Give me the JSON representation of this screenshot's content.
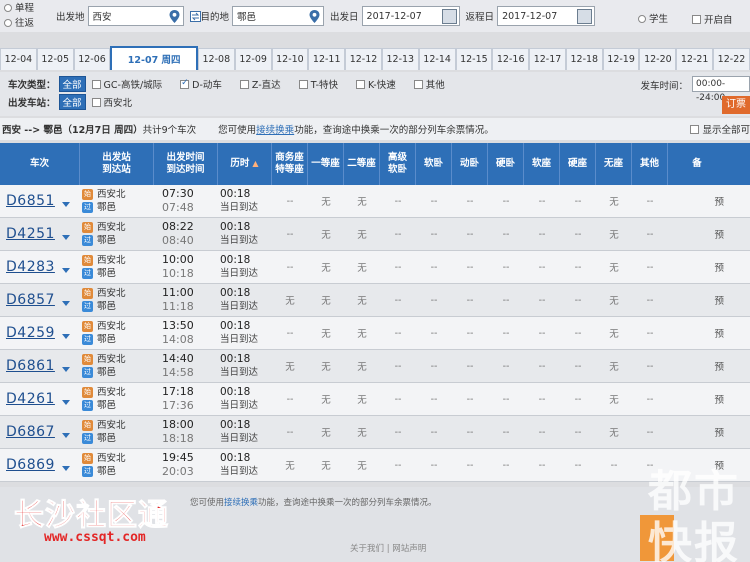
{
  "search": {
    "radio_single": "单程",
    "radio_return": "往返",
    "from_label": "出发地",
    "from_value": "西安",
    "to_label": "目的地",
    "to_value": "鄠邑",
    "date_label": "出发日",
    "date_value": "2017-12-07",
    "return_label": "返程日",
    "return_value": "2017-12-07",
    "passenger_student": "学生",
    "open_option": "开启自"
  },
  "date_tabs": [
    "12-04",
    "12-05",
    "12-06",
    "12-07 周四",
    "12-08",
    "12-09",
    "12-10",
    "12-11",
    "12-12",
    "12-13",
    "12-14",
    "12-15",
    "12-16",
    "12-17",
    "12-18",
    "12-19",
    "12-20",
    "12-21",
    "12-22"
  ],
  "active_date_index": 3,
  "filters": {
    "type_label": "车次类型：",
    "all_label": "全部",
    "options": [
      {
        "label": "GC-高铁/城际",
        "checked": false
      },
      {
        "label": "D-动车",
        "checked": true
      },
      {
        "label": "Z-直达",
        "checked": false
      },
      {
        "label": "T-特快",
        "checked": false
      },
      {
        "label": "K-快速",
        "checked": false
      },
      {
        "label": "其他",
        "checked": false
      }
    ],
    "station_label": "出发车站：",
    "station_all": "全部",
    "station_option": "西安北",
    "time_label": "发车时间：",
    "time_value": "00:00--24:00",
    "book_label": "订票"
  },
  "summary": {
    "route": "西安 --> 鄠邑（12月7日 周四）",
    "count": "共计9个车次",
    "hint_pre": "您可使用",
    "hint_link": "接续换乘",
    "hint_post": "功能，查询途中换乘一次的部分列车余票情况。",
    "show_all": "显示全部可"
  },
  "table": {
    "headers": {
      "train": "车次",
      "station_1": "出发站",
      "station_2": "到达站",
      "time_1": "出发时间",
      "time_2": "到达时间",
      "duration": "历时",
      "sort_indicator": "▲",
      "biz_1": "商务座",
      "biz_2": "特等座",
      "first": "一等座",
      "second": "二等座",
      "adv_1": "高级",
      "adv_2": "软卧",
      "soft_sleeper": "软卧",
      "moving_sleeper": "动卧",
      "hard_sleeper": "硬卧",
      "soft_seat": "软座",
      "hard_seat": "硬座",
      "standing": "无座",
      "other": "其他",
      "note": "备"
    },
    "badge_start": "始",
    "badge_end": "过",
    "rows": [
      {
        "train": "D6851",
        "from": "西安北",
        "to": "鄠邑",
        "dep": "07:30",
        "arr": "07:48",
        "dur": "00:18",
        "day": "当日到达",
        "seats": [
          "--",
          "无",
          "无",
          "--",
          "--",
          "--",
          "--",
          "--",
          "--",
          "无",
          "--"
        ]
      },
      {
        "train": "D4251",
        "from": "西安北",
        "to": "鄠邑",
        "dep": "08:22",
        "arr": "08:40",
        "dur": "00:18",
        "day": "当日到达",
        "seats": [
          "--",
          "无",
          "无",
          "--",
          "--",
          "--",
          "--",
          "--",
          "--",
          "无",
          "--"
        ]
      },
      {
        "train": "D4283",
        "from": "西安北",
        "to": "鄠邑",
        "dep": "10:00",
        "arr": "10:18",
        "dur": "00:18",
        "day": "当日到达",
        "seats": [
          "--",
          "无",
          "无",
          "--",
          "--",
          "--",
          "--",
          "--",
          "--",
          "无",
          "--"
        ]
      },
      {
        "train": "D6857",
        "from": "西安北",
        "to": "鄠邑",
        "dep": "11:00",
        "arr": "11:18",
        "dur": "00:18",
        "day": "当日到达",
        "seats": [
          "无",
          "无",
          "无",
          "--",
          "--",
          "--",
          "--",
          "--",
          "--",
          "无",
          "--"
        ]
      },
      {
        "train": "D4259",
        "from": "西安北",
        "to": "鄠邑",
        "dep": "13:50",
        "arr": "14:08",
        "dur": "00:18",
        "day": "当日到达",
        "seats": [
          "--",
          "无",
          "无",
          "--",
          "--",
          "--",
          "--",
          "--",
          "--",
          "无",
          "--"
        ]
      },
      {
        "train": "D6861",
        "from": "西安北",
        "to": "鄠邑",
        "dep": "14:40",
        "arr": "14:58",
        "dur": "00:18",
        "day": "当日到达",
        "seats": [
          "无",
          "无",
          "无",
          "--",
          "--",
          "--",
          "--",
          "--",
          "--",
          "无",
          "--"
        ]
      },
      {
        "train": "D4261",
        "from": "西安北",
        "to": "鄠邑",
        "dep": "17:18",
        "arr": "17:36",
        "dur": "00:18",
        "day": "当日到达",
        "seats": [
          "--",
          "无",
          "无",
          "--",
          "--",
          "--",
          "--",
          "--",
          "--",
          "无",
          "--"
        ]
      },
      {
        "train": "D6867",
        "from": "西安北",
        "to": "鄠邑",
        "dep": "18:00",
        "arr": "18:18",
        "dur": "00:18",
        "day": "当日到达",
        "seats": [
          "--",
          "无",
          "无",
          "--",
          "--",
          "--",
          "--",
          "--",
          "--",
          "无",
          "--"
        ]
      },
      {
        "train": "D6869",
        "from": "西安北",
        "to": "鄠邑",
        "dep": "19:45",
        "arr": "20:03",
        "dur": "00:18",
        "day": "当日到达",
        "seats": [
          "无",
          "无",
          "无",
          "--",
          "--",
          "--",
          "--",
          "--",
          "--",
          "--",
          "--"
        ]
      }
    ],
    "row_note": "预"
  },
  "footer": {
    "hint_pre": "您可使用",
    "hint_link": "接续换乘",
    "hint_post": "功能，查询途中换乘一次的部分列车余票情况。",
    "links": "关于我们 | 网站声明"
  },
  "watermarks": {
    "left_title": "长沙社区通",
    "left_url": "www.cssqt.com",
    "right_line1": "都市",
    "right_line2": "快报"
  }
}
